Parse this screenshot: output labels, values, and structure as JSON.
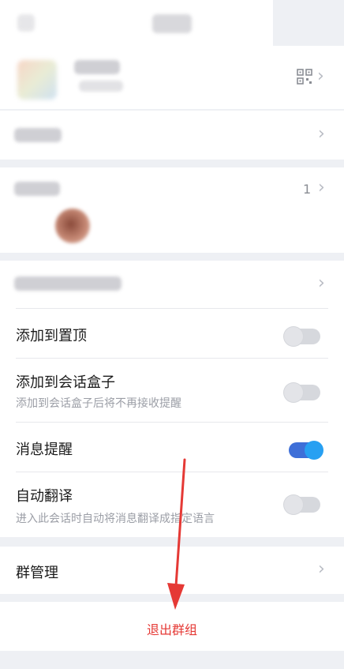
{
  "header": {
    "back_icon": "back-arrow-icon",
    "title_blurred": ""
  },
  "profile": {
    "qr_icon": "qr-code-icon"
  },
  "sections": {
    "members": {
      "count": "1"
    }
  },
  "settings": [
    {
      "label": "添加到置顶",
      "sublabel": "",
      "on": false
    },
    {
      "label": "添加到会话盒子",
      "sublabel": "添加到会话盒子后将不再接收提醒",
      "on": false
    },
    {
      "label": "消息提醒",
      "sublabel": "",
      "on": true
    },
    {
      "label": "自动翻译",
      "sublabel": "进入此会话时自动将消息翻译成指定语言",
      "on": false
    }
  ],
  "group_manage": {
    "label": "群管理"
  },
  "exit": {
    "label": "退出群组"
  },
  "colors": {
    "accent_red": "#e53935",
    "toggle_on": "#27a0f2"
  }
}
